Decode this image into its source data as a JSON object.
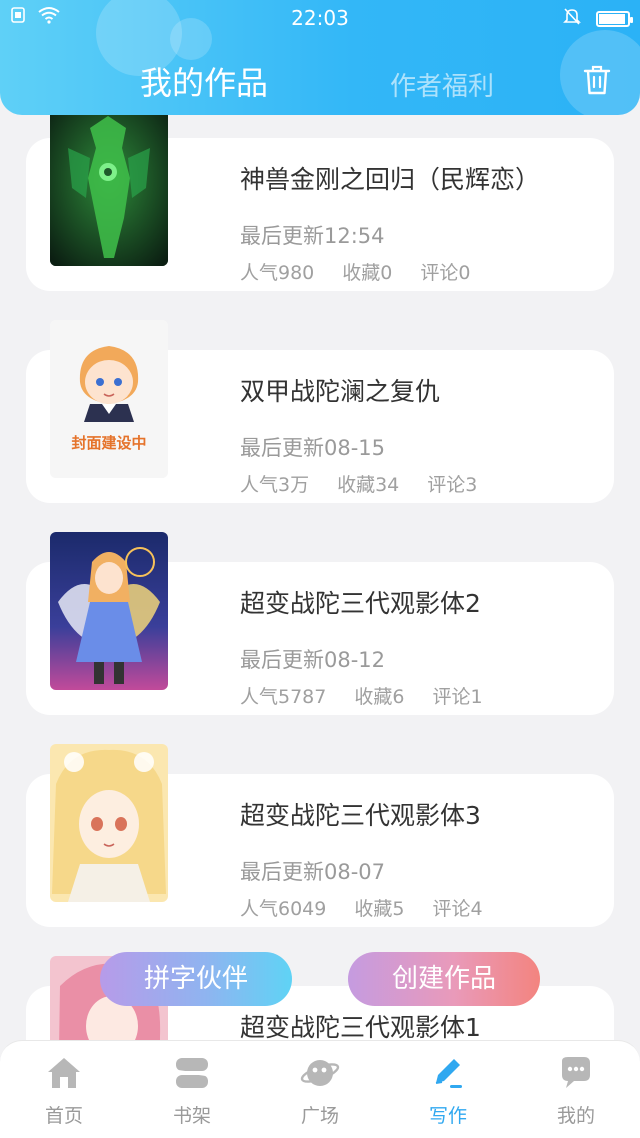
{
  "status": {
    "time": "22:03"
  },
  "header": {
    "tab_mine": "我的作品",
    "tab_welfare": "作者福利"
  },
  "works": [
    {
      "title": "神兽金刚之回归（民辉恋）",
      "updated": "最后更新12:54",
      "popularity": "人气980",
      "favorites": "收藏0",
      "comments": "评论0",
      "cover": "green-armor-art"
    },
    {
      "title": "双甲战陀澜之复仇",
      "updated": "最后更新08-15",
      "popularity": "人气3万",
      "favorites": "收藏34",
      "comments": "评论3",
      "cover": "cover-under-construction",
      "cover_text": "封面建设中"
    },
    {
      "title": "超变战陀三代观影体2",
      "updated": "最后更新08-12",
      "popularity": "人气5787",
      "favorites": "收藏6",
      "comments": "评论1",
      "cover": "angel-girl-art"
    },
    {
      "title": "超变战陀三代观影体3",
      "updated": "最后更新08-07",
      "popularity": "人气6049",
      "favorites": "收藏5",
      "comments": "评论4",
      "cover": "blonde-girl-art"
    },
    {
      "title": "超变战陀三代观影体1",
      "cover": "pink-hair-art"
    }
  ],
  "buttons": {
    "partner": "拼字伙伴",
    "create": "创建作品"
  },
  "nav": [
    {
      "label": "首页",
      "icon": "home-icon",
      "active": false
    },
    {
      "label": "书架",
      "icon": "bookshelf-icon",
      "active": false
    },
    {
      "label": "广场",
      "icon": "planet-icon",
      "active": false
    },
    {
      "label": "写作",
      "icon": "pen-icon",
      "active": true
    },
    {
      "label": "我的",
      "icon": "chat-bubble-icon",
      "active": false
    }
  ],
  "colors": {
    "accent": "#30a8f0",
    "header_start": "#5fd0f7",
    "header_end": "#2bb2f6"
  }
}
